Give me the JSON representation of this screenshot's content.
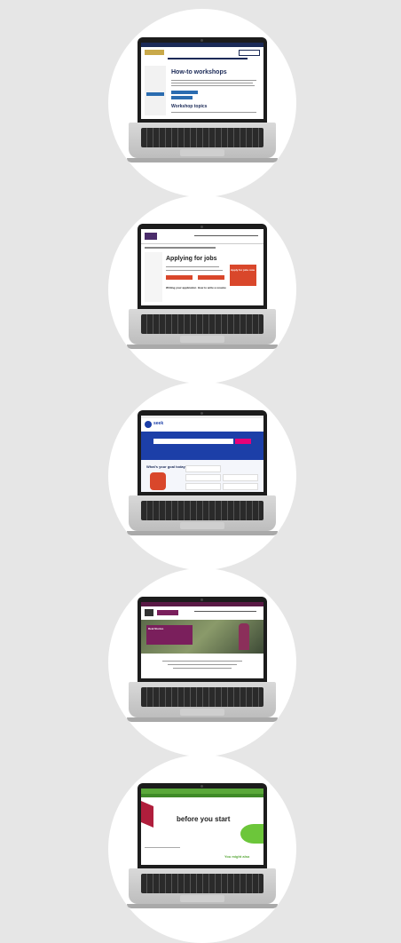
{
  "screens": [
    {
      "id": "how-to-workshops",
      "heading": "How-to workshops",
      "subheading": "Workshop topics"
    },
    {
      "id": "applying-for-jobs",
      "heading": "Applying for jobs",
      "cta": "Apply for jobs now",
      "cards": [
        "Writing your application",
        "How to write a resume"
      ]
    },
    {
      "id": "seek-goal",
      "brand": "seek",
      "headline": "What's your goal today?"
    },
    {
      "id": "disability-site",
      "banner_heading": "Real Stories"
    },
    {
      "id": "before-you-start",
      "heading": "before you start",
      "footer_text": "You might also"
    }
  ],
  "colors": {
    "background": "#e6e6e6",
    "circle": "#ffffff",
    "navy": "#1b2a57",
    "red": "#d9472b",
    "seek_blue": "#1c3fa8",
    "purple": "#7a1f5c",
    "green": "#5aa83a"
  }
}
